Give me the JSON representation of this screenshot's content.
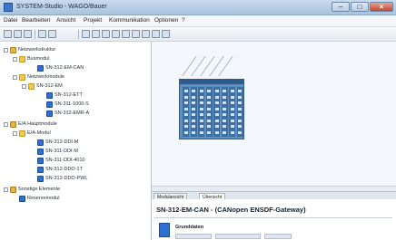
{
  "window": {
    "title": "SYSTEM-Studio - WAGO/Bauer"
  },
  "menubar": {
    "items": [
      "Datei",
      "Bearbeiten",
      "Ansicht",
      "Projekt",
      "Kommunikation",
      "Optionen",
      "?"
    ]
  },
  "sidebar": {
    "tree": [
      {
        "label": "Netzwerkstruktur",
        "level": 0,
        "icon": "project-icon"
      },
      {
        "label": "Busmodul",
        "level": 1,
        "icon": "folder-icon"
      },
      {
        "label": "SN-312-EM-CAN",
        "level": 2,
        "icon": "module-icon"
      },
      {
        "label": "Netzwerkmodule",
        "level": 1,
        "icon": "folder-icon"
      },
      {
        "label": "SN-312-EM",
        "level": 2,
        "icon": "folder-icon"
      },
      {
        "label": "SN-312-ETT",
        "level": 3,
        "icon": "module-icon"
      },
      {
        "label": "SN-311-1000-S",
        "level": 3,
        "icon": "module-icon"
      },
      {
        "label": "SN-312-EMR-A",
        "level": 3,
        "icon": "module-icon"
      },
      {
        "label": "E/A Hauptmodule",
        "level": 0,
        "icon": "project-icon"
      },
      {
        "label": "E/A-Modul",
        "level": 1,
        "icon": "folder-icon"
      },
      {
        "label": "SN-312-DDI-M",
        "level": 2,
        "icon": "module-icon"
      },
      {
        "label": "SN-311-DDI-M",
        "level": 2,
        "icon": "module-icon"
      },
      {
        "label": "SN-311-DDI-4010",
        "level": 2,
        "icon": "module-icon"
      },
      {
        "label": "SN-312-DDO-1T",
        "level": 2,
        "icon": "module-icon"
      },
      {
        "label": "SN-312-DDO-PWL",
        "level": 2,
        "icon": "module-icon"
      },
      {
        "label": "Sonstige Elemente",
        "level": 0,
        "icon": "project-icon"
      },
      {
        "label": "Reservemodul",
        "level": 1,
        "icon": "module-icon"
      }
    ]
  },
  "tabs": [
    {
      "label": "Modulansicht"
    },
    {
      "label": "Übersicht"
    }
  ],
  "detail": {
    "title": "SN-312-EM-CAN - (CANopen ENSDF-Gateway)",
    "section": "Grunddaten"
  }
}
